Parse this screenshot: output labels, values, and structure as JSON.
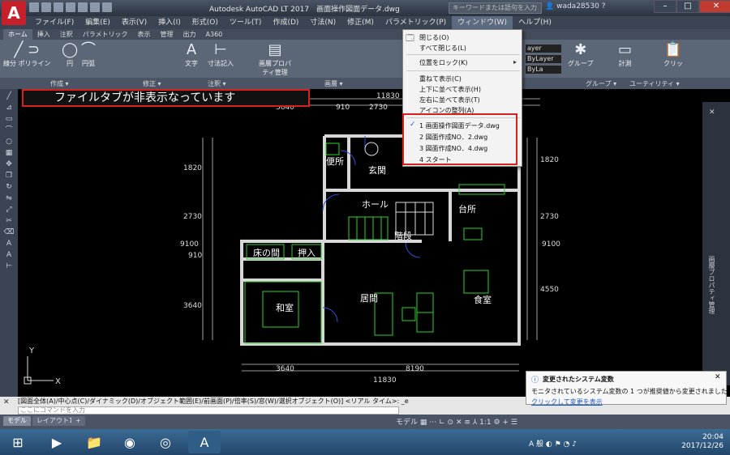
{
  "app": {
    "title": "Autodesk AutoCAD LT 2017　画面操作図面データ.dwg",
    "search_placeholder": "キーワードまたは語句を入力",
    "user": "wada28530",
    "logo": "A"
  },
  "menu": {
    "items": [
      "ファイル(F)",
      "編集(E)",
      "表示(V)",
      "挿入(I)",
      "形式(O)",
      "ツール(T)",
      "作成(D)",
      "寸法(N)",
      "修正(M)",
      "パラメトリック(P)",
      "ウィンドウ(W)",
      "ヘルプ(H)"
    ],
    "active_index": 10
  },
  "ribbon": {
    "tabs": [
      "ホーム",
      "挿入",
      "注釈",
      "パラメトリック",
      "表示",
      "管理",
      "出力",
      "A360"
    ],
    "buttons": {
      "polyline": "線分 ポリライン",
      "circle": "円",
      "arc": "円弧",
      "text": "文字",
      "dim": "寸法記入",
      "layer_props": "画層プロパティ管理",
      "group": "グループ",
      "measure": "計測",
      "clip": "クリッ"
    },
    "panels": {
      "draw": "作成 ▾",
      "modify": "修正 ▾",
      "annot": "注釈 ▾",
      "layer": "画層 ▾",
      "group": "グループ ▾",
      "util": "ユーティリティ ▾"
    },
    "bylayer1": "ayer",
    "bylayer2": "ByLayer",
    "bylayer3": "ByLa"
  },
  "annotation": {
    "text": "ファイルタブが非表示なっています"
  },
  "window_menu": {
    "items": [
      {
        "label": "閉じる(O)",
        "check": ""
      },
      {
        "label": "すべて閉じる(L)",
        "check": ""
      },
      {
        "label": "位置をロック(K)",
        "check": ""
      },
      {
        "label": "重ねて表示(C)",
        "check": ""
      },
      {
        "label": "上下に並べて表示(H)",
        "check": ""
      },
      {
        "label": "左右に並べて表示(T)",
        "check": ""
      },
      {
        "label": "アイコンの整列(A)",
        "check": ""
      },
      {
        "label": "1 画面操作図面データ.dwg",
        "check": "✓"
      },
      {
        "label": "2 図面作成NO．2.dwg",
        "check": ""
      },
      {
        "label": "3 図面作成NO．4.dwg",
        "check": ""
      },
      {
        "label": "4 スタート",
        "check": ""
      }
    ]
  },
  "drawing": {
    "dims_top": [
      "3640",
      "910",
      "2730",
      "11830"
    ],
    "dims_bottom": [
      "3640",
      "8190",
      "11830"
    ],
    "dims_left": [
      "1820",
      "2730",
      "9100",
      "910",
      "3640"
    ],
    "dims_right": [
      "1820",
      "2730",
      "9100",
      "4550"
    ],
    "rooms": [
      "便所",
      "玄関",
      "ホール",
      "台所",
      "階段",
      "床の間",
      "押入",
      "和室",
      "居間",
      "食室"
    ],
    "axis_x": "X",
    "axis_y": "Y"
  },
  "command": {
    "history": "[図面全体(A)/中心点(C)/ダイナミック(D)/オブジェクト範囲(E)/前画面(P)/倍率(S)/窓(W)/選択オブジェクト(O)] <リアル タイム>: _e",
    "placeholder": "ここにコマンドを入力"
  },
  "layout_tabs": [
    "モデル",
    "レイアウト1",
    "+"
  ],
  "status": {
    "model": "モデル",
    "scale": "1:1"
  },
  "notification": {
    "title": "変更されたシステム変数",
    "body": "モニタされているシステム変数の 1 つが推奨値から変更されました",
    "link": "クリックして変更を表示"
  },
  "taskbar": {
    "time": "20:04",
    "date": "2017/12/26",
    "ime": "A 般"
  },
  "right_palette": "画層プロパティ管理"
}
